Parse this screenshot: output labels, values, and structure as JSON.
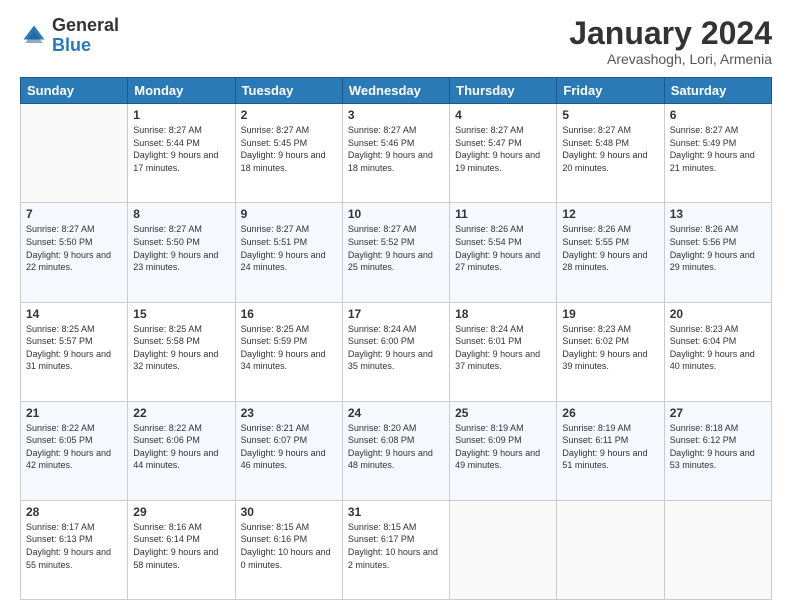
{
  "logo": {
    "general": "General",
    "blue": "Blue"
  },
  "header": {
    "title": "January 2024",
    "subtitle": "Arevashogh, Lori, Armenia"
  },
  "weekdays": [
    "Sunday",
    "Monday",
    "Tuesday",
    "Wednesday",
    "Thursday",
    "Friday",
    "Saturday"
  ],
  "weeks": [
    [
      {
        "day": "",
        "sunrise": "",
        "sunset": "",
        "daylight": ""
      },
      {
        "day": "1",
        "sunrise": "Sunrise: 8:27 AM",
        "sunset": "Sunset: 5:44 PM",
        "daylight": "Daylight: 9 hours and 17 minutes."
      },
      {
        "day": "2",
        "sunrise": "Sunrise: 8:27 AM",
        "sunset": "Sunset: 5:45 PM",
        "daylight": "Daylight: 9 hours and 18 minutes."
      },
      {
        "day": "3",
        "sunrise": "Sunrise: 8:27 AM",
        "sunset": "Sunset: 5:46 PM",
        "daylight": "Daylight: 9 hours and 18 minutes."
      },
      {
        "day": "4",
        "sunrise": "Sunrise: 8:27 AM",
        "sunset": "Sunset: 5:47 PM",
        "daylight": "Daylight: 9 hours and 19 minutes."
      },
      {
        "day": "5",
        "sunrise": "Sunrise: 8:27 AM",
        "sunset": "Sunset: 5:48 PM",
        "daylight": "Daylight: 9 hours and 20 minutes."
      },
      {
        "day": "6",
        "sunrise": "Sunrise: 8:27 AM",
        "sunset": "Sunset: 5:49 PM",
        "daylight": "Daylight: 9 hours and 21 minutes."
      }
    ],
    [
      {
        "day": "7",
        "sunrise": "Sunrise: 8:27 AM",
        "sunset": "Sunset: 5:50 PM",
        "daylight": "Daylight: 9 hours and 22 minutes."
      },
      {
        "day": "8",
        "sunrise": "Sunrise: 8:27 AM",
        "sunset": "Sunset: 5:50 PM",
        "daylight": "Daylight: 9 hours and 23 minutes."
      },
      {
        "day": "9",
        "sunrise": "Sunrise: 8:27 AM",
        "sunset": "Sunset: 5:51 PM",
        "daylight": "Daylight: 9 hours and 24 minutes."
      },
      {
        "day": "10",
        "sunrise": "Sunrise: 8:27 AM",
        "sunset": "Sunset: 5:52 PM",
        "daylight": "Daylight: 9 hours and 25 minutes."
      },
      {
        "day": "11",
        "sunrise": "Sunrise: 8:26 AM",
        "sunset": "Sunset: 5:54 PM",
        "daylight": "Daylight: 9 hours and 27 minutes."
      },
      {
        "day": "12",
        "sunrise": "Sunrise: 8:26 AM",
        "sunset": "Sunset: 5:55 PM",
        "daylight": "Daylight: 9 hours and 28 minutes."
      },
      {
        "day": "13",
        "sunrise": "Sunrise: 8:26 AM",
        "sunset": "Sunset: 5:56 PM",
        "daylight": "Daylight: 9 hours and 29 minutes."
      }
    ],
    [
      {
        "day": "14",
        "sunrise": "Sunrise: 8:25 AM",
        "sunset": "Sunset: 5:57 PM",
        "daylight": "Daylight: 9 hours and 31 minutes."
      },
      {
        "day": "15",
        "sunrise": "Sunrise: 8:25 AM",
        "sunset": "Sunset: 5:58 PM",
        "daylight": "Daylight: 9 hours and 32 minutes."
      },
      {
        "day": "16",
        "sunrise": "Sunrise: 8:25 AM",
        "sunset": "Sunset: 5:59 PM",
        "daylight": "Daylight: 9 hours and 34 minutes."
      },
      {
        "day": "17",
        "sunrise": "Sunrise: 8:24 AM",
        "sunset": "Sunset: 6:00 PM",
        "daylight": "Daylight: 9 hours and 35 minutes."
      },
      {
        "day": "18",
        "sunrise": "Sunrise: 8:24 AM",
        "sunset": "Sunset: 6:01 PM",
        "daylight": "Daylight: 9 hours and 37 minutes."
      },
      {
        "day": "19",
        "sunrise": "Sunrise: 8:23 AM",
        "sunset": "Sunset: 6:02 PM",
        "daylight": "Daylight: 9 hours and 39 minutes."
      },
      {
        "day": "20",
        "sunrise": "Sunrise: 8:23 AM",
        "sunset": "Sunset: 6:04 PM",
        "daylight": "Daylight: 9 hours and 40 minutes."
      }
    ],
    [
      {
        "day": "21",
        "sunrise": "Sunrise: 8:22 AM",
        "sunset": "Sunset: 6:05 PM",
        "daylight": "Daylight: 9 hours and 42 minutes."
      },
      {
        "day": "22",
        "sunrise": "Sunrise: 8:22 AM",
        "sunset": "Sunset: 6:06 PM",
        "daylight": "Daylight: 9 hours and 44 minutes."
      },
      {
        "day": "23",
        "sunrise": "Sunrise: 8:21 AM",
        "sunset": "Sunset: 6:07 PM",
        "daylight": "Daylight: 9 hours and 46 minutes."
      },
      {
        "day": "24",
        "sunrise": "Sunrise: 8:20 AM",
        "sunset": "Sunset: 6:08 PM",
        "daylight": "Daylight: 9 hours and 48 minutes."
      },
      {
        "day": "25",
        "sunrise": "Sunrise: 8:19 AM",
        "sunset": "Sunset: 6:09 PM",
        "daylight": "Daylight: 9 hours and 49 minutes."
      },
      {
        "day": "26",
        "sunrise": "Sunrise: 8:19 AM",
        "sunset": "Sunset: 6:11 PM",
        "daylight": "Daylight: 9 hours and 51 minutes."
      },
      {
        "day": "27",
        "sunrise": "Sunrise: 8:18 AM",
        "sunset": "Sunset: 6:12 PM",
        "daylight": "Daylight: 9 hours and 53 minutes."
      }
    ],
    [
      {
        "day": "28",
        "sunrise": "Sunrise: 8:17 AM",
        "sunset": "Sunset: 6:13 PM",
        "daylight": "Daylight: 9 hours and 55 minutes."
      },
      {
        "day": "29",
        "sunrise": "Sunrise: 8:16 AM",
        "sunset": "Sunset: 6:14 PM",
        "daylight": "Daylight: 9 hours and 58 minutes."
      },
      {
        "day": "30",
        "sunrise": "Sunrise: 8:15 AM",
        "sunset": "Sunset: 6:16 PM",
        "daylight": "Daylight: 10 hours and 0 minutes."
      },
      {
        "day": "31",
        "sunrise": "Sunrise: 8:15 AM",
        "sunset": "Sunset: 6:17 PM",
        "daylight": "Daylight: 10 hours and 2 minutes."
      },
      {
        "day": "",
        "sunrise": "",
        "sunset": "",
        "daylight": ""
      },
      {
        "day": "",
        "sunrise": "",
        "sunset": "",
        "daylight": ""
      },
      {
        "day": "",
        "sunrise": "",
        "sunset": "",
        "daylight": ""
      }
    ]
  ]
}
